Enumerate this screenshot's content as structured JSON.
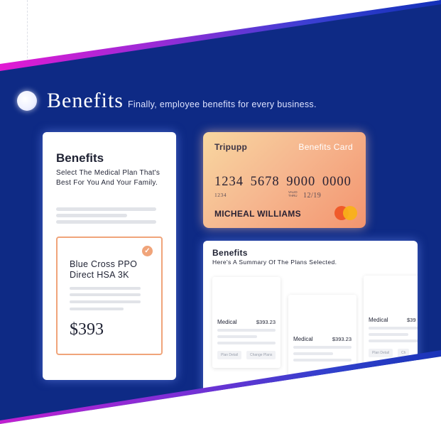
{
  "header": {
    "title": "Benefits",
    "subtitle": "Finally, employee benefits for every business."
  },
  "plan_card": {
    "title": "Benefits",
    "description": "Select The Medical Plan That's Best For You And Your Family.",
    "selected_plan": {
      "name": "Blue Cross PPO Direct HSA 3K",
      "price": "$393",
      "check_icon": "check-icon"
    }
  },
  "benefits_card": {
    "brand": "Tripupp",
    "type": "Benefits Card",
    "number": "1234 5678 9000 0000",
    "number_small": "1234",
    "valid_thru": "VALID THRU",
    "expiry": "12/19",
    "holder": "MICHEAL WILLIAMS",
    "network_icon": "mastercard-icon"
  },
  "summary": {
    "title": "Benefits",
    "description": "Here's A Summary Of The Plans Selected.",
    "plans": [
      {
        "label": "Medical",
        "price": "$393.23",
        "buttons": [
          "Plan Detail",
          "Change Plans"
        ]
      },
      {
        "label": "Medical",
        "price": "$393.23"
      },
      {
        "label": "Medical",
        "price": "$39",
        "buttons": [
          "Plan Detail",
          "Ch"
        ]
      }
    ]
  },
  "colors": {
    "panel_blue": "#0e2a85",
    "accent_orange": "#f0a47a",
    "stripe_magenta": "#e21ad3"
  }
}
